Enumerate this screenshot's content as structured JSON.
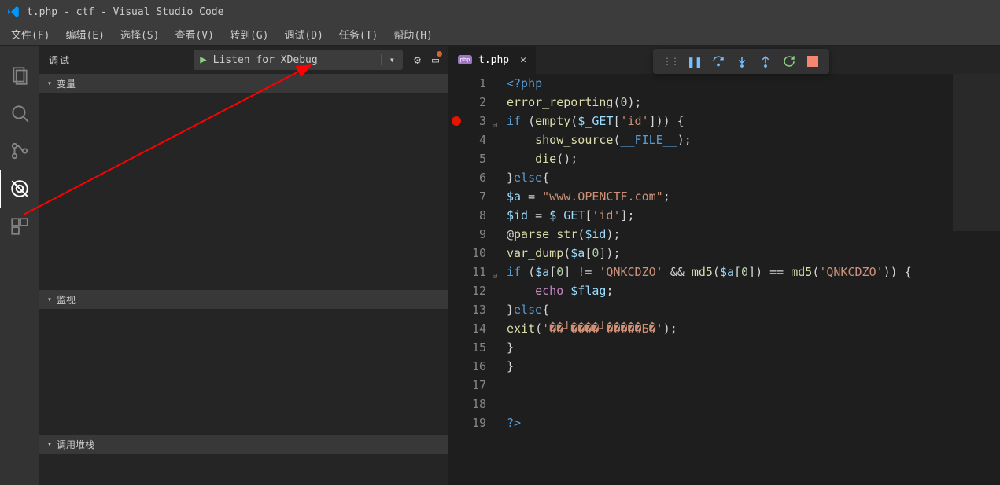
{
  "title": "t.php - ctf - Visual Studio Code",
  "menu": [
    "文件(F)",
    "编辑(E)",
    "选择(S)",
    "查看(V)",
    "转到(G)",
    "调试(D)",
    "任务(T)",
    "帮助(H)"
  ],
  "sidebar": {
    "title": "调试",
    "config": "Listen for XDebug",
    "panels": [
      "变量",
      "监视",
      "调用堆栈"
    ]
  },
  "tab": {
    "name": "t.php"
  },
  "code": {
    "lines": [
      {
        "n": 1,
        "html": "<span class='c-open'>&lt;?php</span>"
      },
      {
        "n": 2,
        "html": "<span class='c-fn'>error_reporting</span>(<span class='c-num'>0</span>);"
      },
      {
        "n": 3,
        "bp": true,
        "fold": "⊟",
        "html": "<span class='c-kw'>if</span> (<span class='c-fn'>empty</span>(<span class='c-var'>$_GET</span>[<span class='c-str'>'id'</span>])) {"
      },
      {
        "n": 4,
        "html": "    <span class='c-fn'>show_source</span>(<span class='c-const'>__FILE__</span>);"
      },
      {
        "n": 5,
        "html": "    <span class='c-fn'>die</span>();"
      },
      {
        "n": 6,
        "html": "}<span class='c-kw'>else</span>{"
      },
      {
        "n": 7,
        "html": "<span class='c-var'>$a</span> = <span class='c-str'>\"www.OPENCTF.com\"</span>;"
      },
      {
        "n": 8,
        "html": "<span class='c-var'>$id</span> = <span class='c-var'>$_GET</span>[<span class='c-str'>'id'</span>];"
      },
      {
        "n": 9,
        "html": "@<span class='c-fn'>parse_str</span>(<span class='c-var'>$id</span>);"
      },
      {
        "n": 10,
        "html": "<span class='c-fn'>var_dump</span>(<span class='c-var'>$a</span>[<span class='c-num'>0</span>]);"
      },
      {
        "n": 11,
        "fold": "⊟",
        "html": "<span class='c-kw'>if</span> (<span class='c-var'>$a</span>[<span class='c-num'>0</span>] != <span class='c-str'>'QNKCDZO'</span> &amp;&amp; <span class='c-fn'>md5</span>(<span class='c-var'>$a</span>[<span class='c-num'>0</span>]) == <span class='c-fn'>md5</span>(<span class='c-str'>'QNKCDZO'</span>)) {"
      },
      {
        "n": 12,
        "html": "    <span class='c-echo'>echo</span> <span class='c-var'>$flag</span>;"
      },
      {
        "n": 13,
        "html": "}<span class='c-kw'>else</span>{"
      },
      {
        "n": 14,
        "html": "<span class='c-fn'>exit</span>(<span class='c-str'>'��┘����┘�����Ƃ�'</span>);"
      },
      {
        "n": 15,
        "html": "}"
      },
      {
        "n": 16,
        "html": "}"
      },
      {
        "n": 17,
        "html": ""
      },
      {
        "n": 18,
        "html": ""
      },
      {
        "n": 19,
        "html": "<span class='c-open'>?&gt;</span>"
      }
    ]
  }
}
